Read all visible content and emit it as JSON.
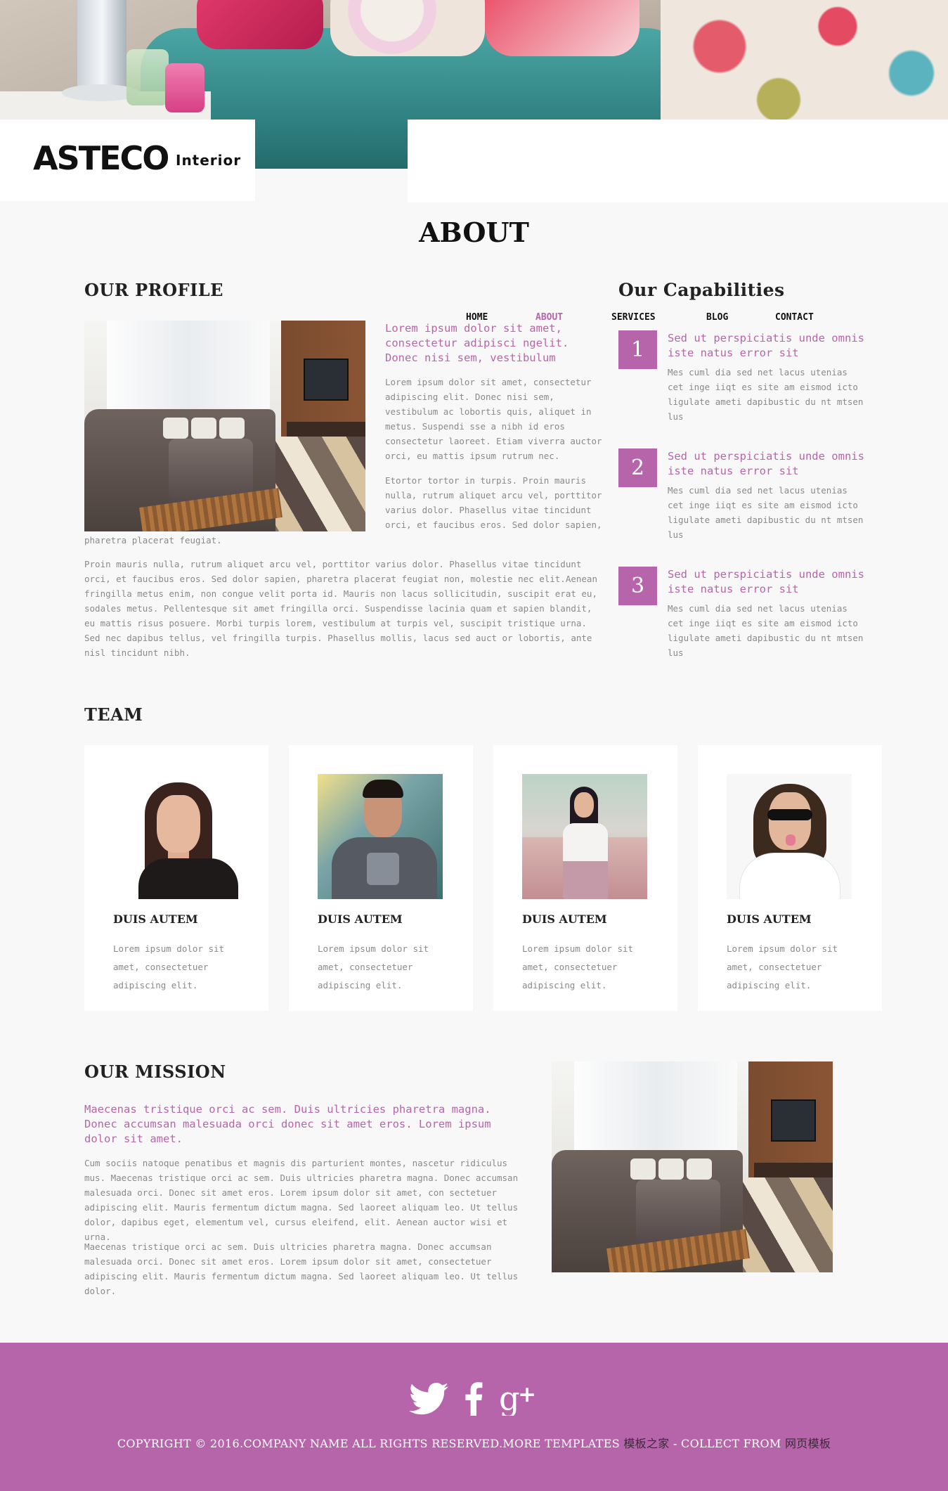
{
  "brand": {
    "name": "ASTECO",
    "tagline": "Interior"
  },
  "nav": {
    "items": [
      {
        "label": "HOME",
        "active": false
      },
      {
        "label": "ABOUT",
        "active": true
      },
      {
        "label": "SERVICES",
        "active": false
      },
      {
        "label": "BLOG",
        "active": false
      },
      {
        "label": "CONTACT",
        "active": false
      }
    ],
    "active_color": "#b765ab"
  },
  "page_title": "ABOUT",
  "profile": {
    "title": "OUR PROFILE",
    "lead": "Lorem ipsum dolor sit amet, consectetur adipisci ngelit. Donec nisi sem, vestibulum",
    "para1": "Lorem ipsum dolor sit amet, consectetur adipiscing elit. Donec nisi sem, vestibulum ac lobortis quis, aliquet in metus. Suspendi sse a nibh id eros consectetur laoreet. Etiam viverra auctor orci, eu mattis ipsum rutrum nec.",
    "para2": "Etortor tortor in turpis. Proin mauris nulla, rutrum aliquet arcu vel, porttitor varius dolor. Phasellus vitae tincidunt orci, et faucibus eros. Sed dolor sapien,",
    "para2_tail": "pharetra placerat feugiat.",
    "para3": "Proin mauris nulla, rutrum aliquet arcu vel, porttitor varius dolor. Phasellus vitae tincidunt orci, et faucibus eros. Sed dolor sapien, pharetra placerat feugiat non, molestie nec elit.Aenean fringilla metus enim, non congue velit porta id. Mauris non lacus sollicitudin, suscipit erat eu, sodales metus. Pellentesque sit amet fringilla orci. Suspendisse lacinia quam et sapien blandit, eu mattis risus posuere. Morbi turpis lorem, vestibulum at turpis vel, suscipit tristique urna. Sed nec dapibus tellus, vel fringilla turpis. Phasellus mollis, lacus sed auct or lobortis, ante nisl tincidunt nibh."
  },
  "capabilities": {
    "title": "Our Capabilities",
    "items": [
      {
        "number": "1",
        "title": "Sed ut perspiciatis unde omnis iste natus error sit",
        "text": "Mes cuml dia sed net lacus utenias cet inge iiqt es site am eismod icto ligulate ameti dapibustic du nt mtsen lus"
      },
      {
        "number": "2",
        "title": "Sed ut perspiciatis unde omnis iste natus error sit",
        "text": "Mes cuml dia sed net lacus utenias cet inge iiqt es site am eismod icto ligulate ameti dapibustic du nt mtsen lus"
      },
      {
        "number": "3",
        "title": "Sed ut perspiciatis unde omnis iste natus error sit",
        "text": "Mes cuml dia sed net lacus utenias cet inge iiqt es site am eismod icto ligulate ameti dapibustic du nt mtsen lus"
      }
    ]
  },
  "team": {
    "title": "TEAM",
    "members": [
      {
        "name": "DUIS AUTEM",
        "bio": "Lorem ipsum dolor sit amet, consectetuer adipiscing elit."
      },
      {
        "name": "DUIS AUTEM",
        "bio": "Lorem ipsum dolor sit amet, consectetuer adipiscing elit."
      },
      {
        "name": "DUIS AUTEM",
        "bio": "Lorem ipsum dolor sit amet, consectetuer adipiscing elit."
      },
      {
        "name": "DUIS AUTEM",
        "bio": "Lorem ipsum dolor sit amet, consectetuer adipiscing elit."
      }
    ]
  },
  "mission": {
    "title": "OUR MISSION",
    "lead": "Maecenas tristique orci ac sem. Duis ultricies pharetra magna. Donec accumsan malesuada orci donec sit amet eros. Lorem ipsum dolor sit amet.",
    "para1": "Cum sociis natoque penatibus et magnis dis parturient montes, nascetur ridiculus mus. Maecenas tristique orci ac sem. Duis ultricies pharetra magna. Donec accumsan malesuada orci. Donec sit amet eros. Lorem ipsum dolor sit amet, con sectetuer adipiscing elit. Mauris fermentum dictum magna. Sed laoreet aliquam leo. Ut tellus dolor, dapibus eget, elementum vel, cursus eleifend, elit. Aenean auctor wisi et urna.",
    "para2": "Maecenas tristique orci ac sem. Duis ultricies pharetra magna. Donec accumsan malesuada orci. Donec sit amet eros. Lorem ipsum dolor sit amet, consectetuer adipiscing elit. Mauris fermentum dictum magna. Sed laoreet aliquam leo. Ut tellus dolor."
  },
  "footer": {
    "social": [
      {
        "icon": "twitter-icon",
        "glyph": "🐦"
      },
      {
        "icon": "facebook-icon",
        "glyph": "f"
      },
      {
        "icon": "google-plus-icon",
        "glyph": "g+"
      }
    ],
    "copyright_prefix": "COPYRIGHT © 2016.COMPANY NAME ALL RIGHTS RESERVED.MORE TEMPLATES",
    "link1": "模板之家",
    "middle": "- COLLECT FROM",
    "link2": "网页模板",
    "background": "#b765ab"
  }
}
